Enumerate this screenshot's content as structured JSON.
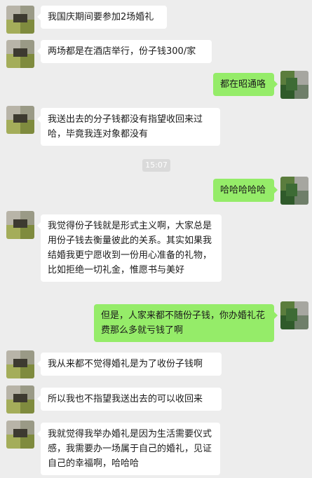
{
  "timestamp": "15:07",
  "messages": [
    {
      "side": "left",
      "text": "我国庆期间要参加2场婚礼"
    },
    {
      "side": "left",
      "text": "两场都是在酒店举行，份子钱300/家"
    },
    {
      "side": "right",
      "text": "都在昭通咯"
    },
    {
      "side": "left",
      "text": "我送出去的分子钱都没有指望收回来过哈，毕竟我连对象都没有"
    },
    {
      "side": "right",
      "text": "哈哈哈哈哈"
    },
    {
      "side": "left",
      "text": "我觉得份子钱就是形式主义啊，大家总是用份子钱去衡量彼此的关系。其实如果我结婚我更宁愿收到一份用心准备的礼物，比如拒绝一切礼金，惟愿书与美好"
    },
    {
      "side": "right",
      "text": "但是，人家来都不随份子钱，你办婚礼花费那么多就亏钱了啊"
    },
    {
      "side": "left",
      "text": "我从来都不觉得婚礼是为了收份子钱啊"
    },
    {
      "side": "left",
      "text": "所以我也不指望我送出去的可以收回来"
    },
    {
      "side": "left",
      "text": "我就觉得我举办婚礼是因为生活需要仪式感，我需要办一场属于自己的婚礼，见证自己的幸福啊，哈哈哈"
    }
  ]
}
